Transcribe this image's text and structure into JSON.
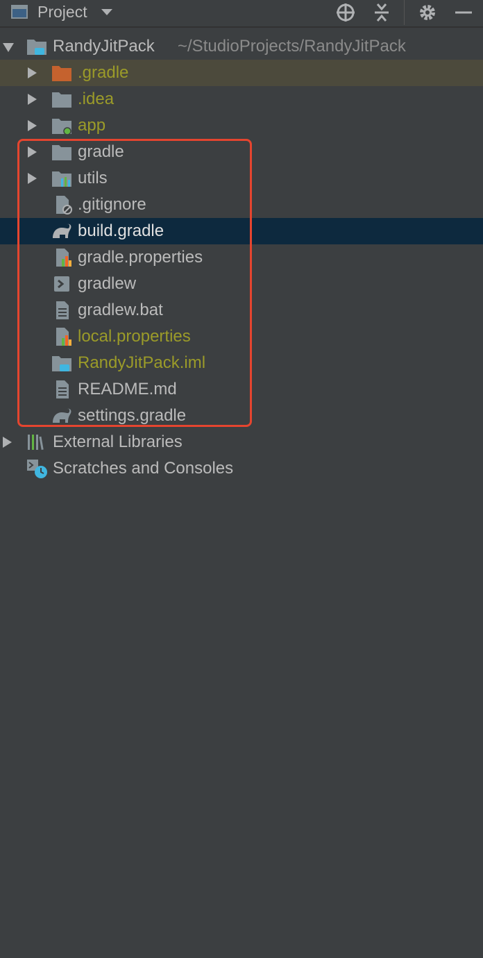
{
  "header": {
    "title": "Project",
    "tools": [
      "locate-icon",
      "collapse-all-icon",
      "gear-icon",
      "minimize-icon"
    ]
  },
  "tree": {
    "root": {
      "name": "RandyJitPack",
      "path": "~/StudioProjects/RandyJitPack"
    },
    "items": [
      {
        "label": ".gradle",
        "color": "#9b9b29"
      },
      {
        "label": ".idea",
        "color": "#9b9b29"
      },
      {
        "label": "app",
        "color": "#9b9b29"
      },
      {
        "label": "gradle",
        "color": "#bbbbbb"
      },
      {
        "label": "utils",
        "color": "#bbbbbb"
      },
      {
        "label": ".gitignore",
        "color": "#bbbbbb"
      },
      {
        "label": "build.gradle",
        "color": "#e0e0e0"
      },
      {
        "label": "gradle.properties",
        "color": "#bbbbbb"
      },
      {
        "label": "gradlew",
        "color": "#bbbbbb"
      },
      {
        "label": "gradlew.bat",
        "color": "#bbbbbb"
      },
      {
        "label": "local.properties",
        "color": "#9b9b29"
      },
      {
        "label": "RandyJitPack.iml",
        "color": "#9b9b29"
      },
      {
        "label": "README.md",
        "color": "#bbbbbb"
      },
      {
        "label": "settings.gradle",
        "color": "#bbbbbb"
      }
    ],
    "external_libraries": "External Libraries",
    "scratches": "Scratches and Consoles"
  },
  "colors": {
    "background": "#3c3f41",
    "selected_row": "#0d293e",
    "excluded_row": "#4c4a3c",
    "highlight_box": "#e5452f"
  }
}
